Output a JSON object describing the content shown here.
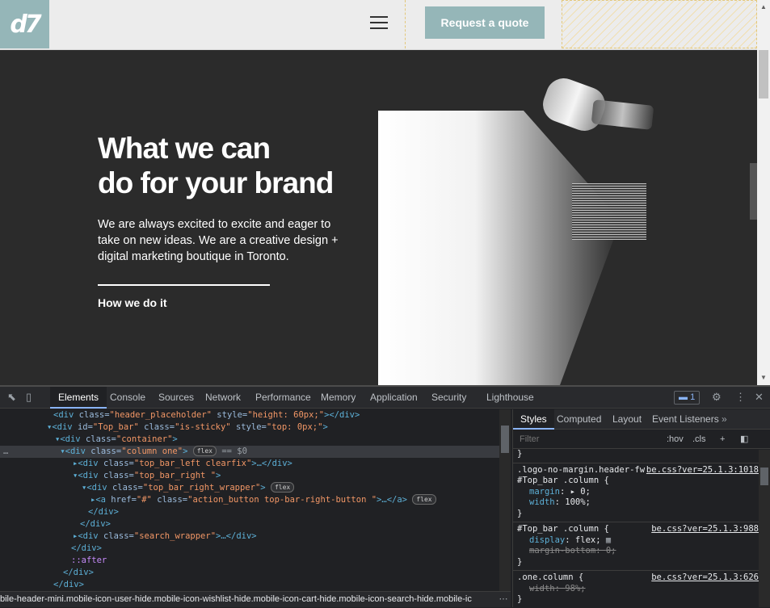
{
  "site": {
    "logo_text": "d7",
    "quote_button": "Request a quote",
    "hero_title_line1": "What we can",
    "hero_title_line2": "do for your brand",
    "hero_text_line1": "We are always excited to excite and eager to",
    "hero_text_line2": "take on new ideas. We are a creative design +",
    "hero_text_line3": "digital marketing boutique in Toronto.",
    "hero_link": "How we do it"
  },
  "devtools": {
    "tabs": [
      "Elements",
      "Console",
      "Sources",
      "Network",
      "Performance",
      "Memory",
      "Application",
      "Security",
      "Lighthouse"
    ],
    "message_count": "1",
    "dom": [
      {
        "text1": "<div ",
        "a1": "class=",
        "v1": "\"header_placeholder\"",
        "a2": " style=",
        "v2": "\"height: 60px;\"",
        "end": "></div>"
      },
      {
        "text1": "<div ",
        "a1": "id=",
        "v1": "\"Top_bar\"",
        "a2": " class=",
        "v2": "\"is-sticky\"",
        "a3": " style=",
        "v3": "\"top: 0px;\"",
        "end": ">"
      },
      {
        "text1": "<div ",
        "a1": "class=",
        "v1": "\"container\"",
        "end": ">"
      },
      {
        "text1": "<div ",
        "a1": "class=",
        "v1": "\"column one\"",
        "end": ">",
        "badge": "flex",
        "eq": "== $0"
      },
      {
        "text1": "<div ",
        "a1": "class=",
        "v1": "\"top_bar_left clearfix\"",
        "end": ">…</div>"
      },
      {
        "text1": "<div ",
        "a1": "class=",
        "v1": "\"top_bar_right \"",
        "end": ">"
      },
      {
        "text1": "<div ",
        "a1": "class=",
        "v1": "\"top_bar_right_wrapper\"",
        "end": ">",
        "badge": "flex"
      },
      {
        "text1": "<a ",
        "a1": "href=",
        "v1": "\"#\"",
        "a2": " class=",
        "v2": "\"action_button top-bar-right-button \"",
        "end": ">…</a>",
        "badge": "flex"
      },
      {
        "text1": "</div>"
      },
      {
        "text1": "</div>"
      },
      {
        "text1": "<div ",
        "a1": "class=",
        "v1": "\"search_wrapper\"",
        "end": ">…</div>"
      },
      {
        "text1": "</div>"
      },
      {
        "pseudo": "::after"
      },
      {
        "text1": "</div>"
      },
      {
        "text1": "</div>"
      }
    ],
    "breadcrumb": "bile-header-mini.mobile-icon-user-hide.mobile-icon-wishlist-hide.mobile-icon-cart-hide.mobile-icon-search-hide.mobile-ic",
    "styles_tabs": [
      "Styles",
      "Computed",
      "Layout",
      "Event Listeners"
    ],
    "filter_placeholder": "Filter",
    "hov": ":hov",
    "cls": ".cls",
    "rules": {
      "r0_close": "}",
      "r1_sel1": ".logo-no-margin.header-fw",
      "r1_sel2": "#Top_bar .column {",
      "r1_src": "be.css?ver=25.1.3:1018",
      "r1_p1": "margin",
      "r1_v1": "▸ 0;",
      "r1_p2": "width",
      "r1_v2": "100%;",
      "r1_close": "}",
      "r2_sel": "#Top_bar .column {",
      "r2_src": "be.css?ver=25.1.3:988",
      "r2_p1": "display",
      "r2_v1": "flex;",
      "r2_p2": "margin-bottom",
      "r2_v2": "0;",
      "r2_close": "}",
      "r3_sel": ".one.column {",
      "r3_src": "be.css?ver=25.1.3:626",
      "r3_p1": "width",
      "r3_v1": "98%;",
      "r3_close": "}"
    }
  }
}
